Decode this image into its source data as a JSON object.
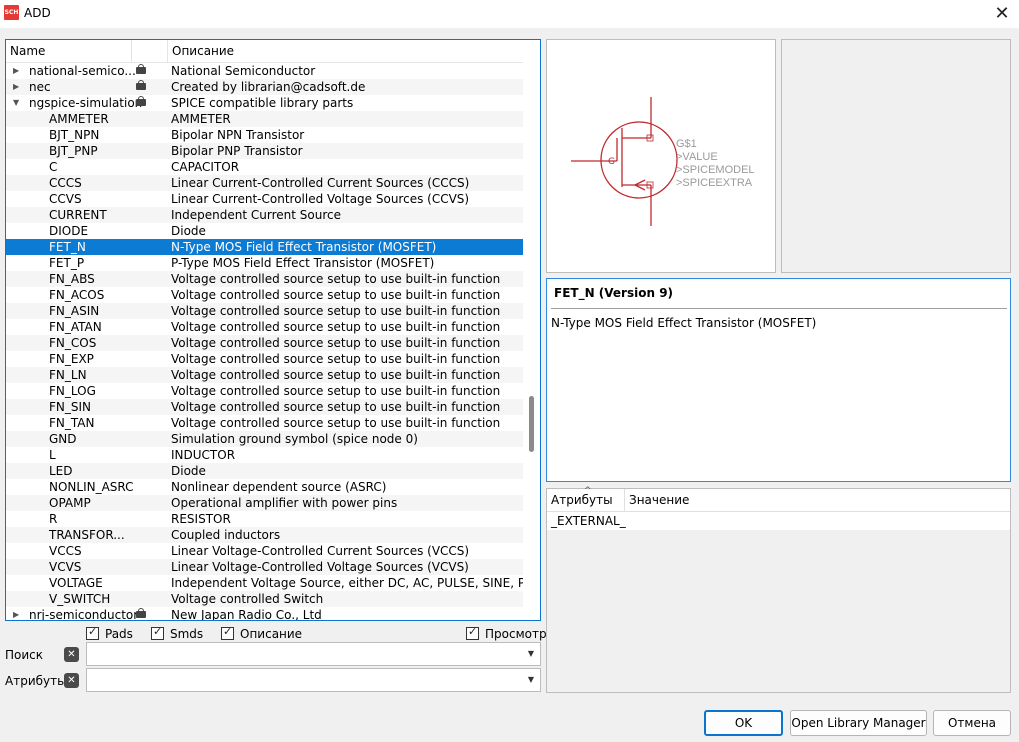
{
  "window": {
    "title": "ADD",
    "app_icon_text": "SCH"
  },
  "tree": {
    "columns": {
      "name": "Name",
      "description": "Описание"
    },
    "rows": [
      {
        "name": "national-semico...",
        "desc": "National Semiconductor",
        "level": 0,
        "expander": "▶",
        "lock": true
      },
      {
        "name": "nec",
        "desc": "Created by librarian@cadsoft.de",
        "level": 0,
        "expander": "▶",
        "lock": true
      },
      {
        "name": "ngspice-simulation",
        "desc": "SPICE compatible library parts",
        "level": 0,
        "expander": "▼",
        "lock": true
      },
      {
        "name": "AMMETER",
        "desc": "AMMETER",
        "level": 1
      },
      {
        "name": "BJT_NPN",
        "desc": "Bipolar NPN Transistor",
        "level": 1
      },
      {
        "name": "BJT_PNP",
        "desc": "Bipolar PNP Transistor",
        "level": 1
      },
      {
        "name": "C",
        "desc": "CAPACITOR",
        "level": 1
      },
      {
        "name": "CCCS",
        "desc": "Linear Current-Controlled Current Sources (CCCS)",
        "level": 1
      },
      {
        "name": "CCVS",
        "desc": "Linear Current-Controlled Voltage Sources (CCVS)",
        "level": 1
      },
      {
        "name": "CURRENT",
        "desc": "Independent Current Source",
        "level": 1
      },
      {
        "name": "DIODE",
        "desc": "Diode",
        "level": 1
      },
      {
        "name": "FET_N",
        "desc": "N-Type MOS Field Effect Transistor (MOSFET)",
        "level": 1,
        "selected": true
      },
      {
        "name": "FET_P",
        "desc": "P-Type MOS Field Effect Transistor (MOSFET)",
        "level": 1
      },
      {
        "name": "FN_ABS",
        "desc": "Voltage controlled source setup to use built-in function",
        "level": 1
      },
      {
        "name": "FN_ACOS",
        "desc": "Voltage controlled source setup to use built-in function",
        "level": 1
      },
      {
        "name": "FN_ASIN",
        "desc": "Voltage controlled source setup to use built-in function",
        "level": 1
      },
      {
        "name": "FN_ATAN",
        "desc": "Voltage controlled source setup to use built-in function",
        "level": 1
      },
      {
        "name": "FN_COS",
        "desc": "Voltage controlled source setup to use built-in function",
        "level": 1
      },
      {
        "name": "FN_EXP",
        "desc": "Voltage controlled source setup to use built-in function",
        "level": 1
      },
      {
        "name": "FN_LN",
        "desc": "Voltage controlled source setup to use built-in function",
        "level": 1
      },
      {
        "name": "FN_LOG",
        "desc": "Voltage controlled source setup to use built-in function",
        "level": 1
      },
      {
        "name": "FN_SIN",
        "desc": "Voltage controlled source setup to use built-in function",
        "level": 1
      },
      {
        "name": "FN_TAN",
        "desc": "Voltage controlled source setup to use built-in function",
        "level": 1
      },
      {
        "name": "GND",
        "desc": "Simulation ground symbol (spice node 0)",
        "level": 1
      },
      {
        "name": "L",
        "desc": "INDUCTOR",
        "level": 1
      },
      {
        "name": "LED",
        "desc": "Diode",
        "level": 1
      },
      {
        "name": "NONLIN_ASRC",
        "desc": "Nonlinear dependent source (ASRC)",
        "level": 1
      },
      {
        "name": "OPAMP",
        "desc": "Operational amplifier with power pins",
        "level": 1
      },
      {
        "name": "R",
        "desc": "RESISTOR",
        "level": 1
      },
      {
        "name": "TRANSFOR...",
        "desc": "Coupled inductors",
        "level": 1
      },
      {
        "name": "VCCS",
        "desc": "Linear Voltage-Controlled Current Sources (VCCS)",
        "level": 1
      },
      {
        "name": "VCVS",
        "desc": "Linear Voltage-Controlled Voltage Sources (VCVS)",
        "level": 1
      },
      {
        "name": "VOLTAGE",
        "desc": "Independent Voltage Source, either DC, AC, PULSE, SINE, P...",
        "level": 1
      },
      {
        "name": "V_SWITCH",
        "desc": "Voltage controlled Switch",
        "level": 1
      },
      {
        "name": "nrj-semiconductor",
        "desc": "New Japan Radio Co., Ltd",
        "level": 0,
        "expander": "▶",
        "lock": true
      }
    ]
  },
  "options": {
    "pads": "Pads",
    "smds": "Smds",
    "description": "Описание",
    "preview": "Просмотр"
  },
  "search": {
    "label": "Поиск",
    "value": ""
  },
  "attributes_filter": {
    "label": "Атрибуты",
    "value": ""
  },
  "preview": {
    "symbol_texts": [
      "G$1",
      ">VALUE",
      ">SPICEMODEL",
      ">SPICEEXTRA"
    ],
    "gate_label": "G",
    "symbol_color": "#c0282d"
  },
  "info": {
    "title": "FET_N (Version 9)",
    "description": "N-Type MOS Field Effect Transistor (MOSFET)"
  },
  "attributes": {
    "col_name": "Атрибуты",
    "col_value": "Значение",
    "rows": [
      {
        "name": "_EXTERNAL_",
        "value": ""
      }
    ]
  },
  "buttons": {
    "ok": "OK",
    "open_library_manager": "Open Library Manager",
    "cancel": "Отмена"
  },
  "colors": {
    "selection": "#0c7bd4",
    "accent_border": "#0a74d0"
  }
}
